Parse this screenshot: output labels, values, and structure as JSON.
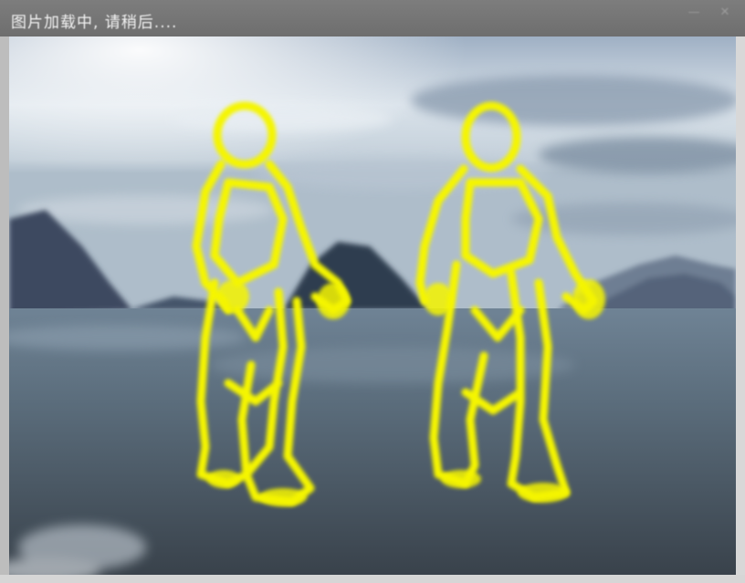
{
  "window": {
    "title": "图片加载中, 请稍后....",
    "controls": {
      "minimize_icon": "minimize-icon",
      "close_icon": "close-icon"
    }
  },
  "image": {
    "description_icon": "scene-image",
    "overlay_color": "#f5f500",
    "subject_count": 2
  }
}
